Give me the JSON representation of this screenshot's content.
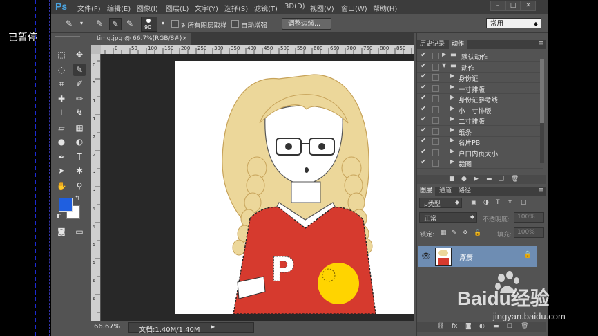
{
  "overlay": {
    "paused": "已暂停"
  },
  "menu": {
    "logo": "Ps",
    "items": [
      "文件(F)",
      "编辑(E)",
      "图像(I)",
      "图层(L)",
      "文字(Y)",
      "选择(S)",
      "滤镜(T)",
      "3D(D)",
      "视图(V)",
      "窗口(W)",
      "帮助(H)"
    ],
    "window_controls": [
      "–",
      "□",
      "✕"
    ]
  },
  "options": {
    "brush_size": "90",
    "sample_all_layers": "对所有图层取样",
    "auto_enhance": "自动增强",
    "refine_edge": "调整边缘...",
    "workspace": "常用"
  },
  "document": {
    "tab_title": "timg.jpg @ 66.7%(RGB/8#)",
    "tab_close": "×",
    "zoom": "66.67%",
    "doc_size": "文档:1.40M/1.40M",
    "ruler_top": [
      "0",
      "50",
      "100",
      "150",
      "200",
      "250",
      "300",
      "350",
      "400",
      "450",
      "500",
      "550",
      "600",
      "650",
      "700",
      "750",
      "800",
      "850"
    ],
    "ruler_left": [
      "0",
      "5",
      "1",
      "1",
      "2",
      "2",
      "3",
      "3",
      "4",
      "4",
      "5",
      "5",
      "6",
      "6"
    ]
  },
  "actions_panel": {
    "tabs": [
      "历史记录",
      "动作"
    ],
    "active_tab": "动作",
    "rows": [
      {
        "label": "默认动作",
        "level": 0,
        "folder": true,
        "expanded": false
      },
      {
        "label": "动作",
        "level": 0,
        "folder": true,
        "expanded": true
      },
      {
        "label": "身份证",
        "level": 1
      },
      {
        "label": "一寸排版",
        "level": 1
      },
      {
        "label": "身份证参考线",
        "level": 1
      },
      {
        "label": "小二寸排版",
        "level": 1
      },
      {
        "label": "二寸排版",
        "level": 1
      },
      {
        "label": "纸条",
        "level": 1
      },
      {
        "label": "名片PB",
        "level": 1
      },
      {
        "label": "户口内页大小",
        "level": 1
      },
      {
        "label": "裁图",
        "level": 1
      }
    ]
  },
  "layers_panel": {
    "tabs": [
      "图层",
      "通道",
      "路径"
    ],
    "kind_filter": "ρ类型",
    "blend_mode": "正常",
    "opacity_label": "不透明度:",
    "opacity_value": "100%",
    "lock_label": "锁定:",
    "fill_label": "填充:",
    "fill_value": "100%",
    "layer_name": "背景"
  },
  "watermark": {
    "brand": "Baidu经验",
    "url": "jingyan.baidu.com"
  },
  "colors": {
    "foreground": "#1f5fe0",
    "background": "#ffffff",
    "selected_layer": "#6e8db3"
  }
}
